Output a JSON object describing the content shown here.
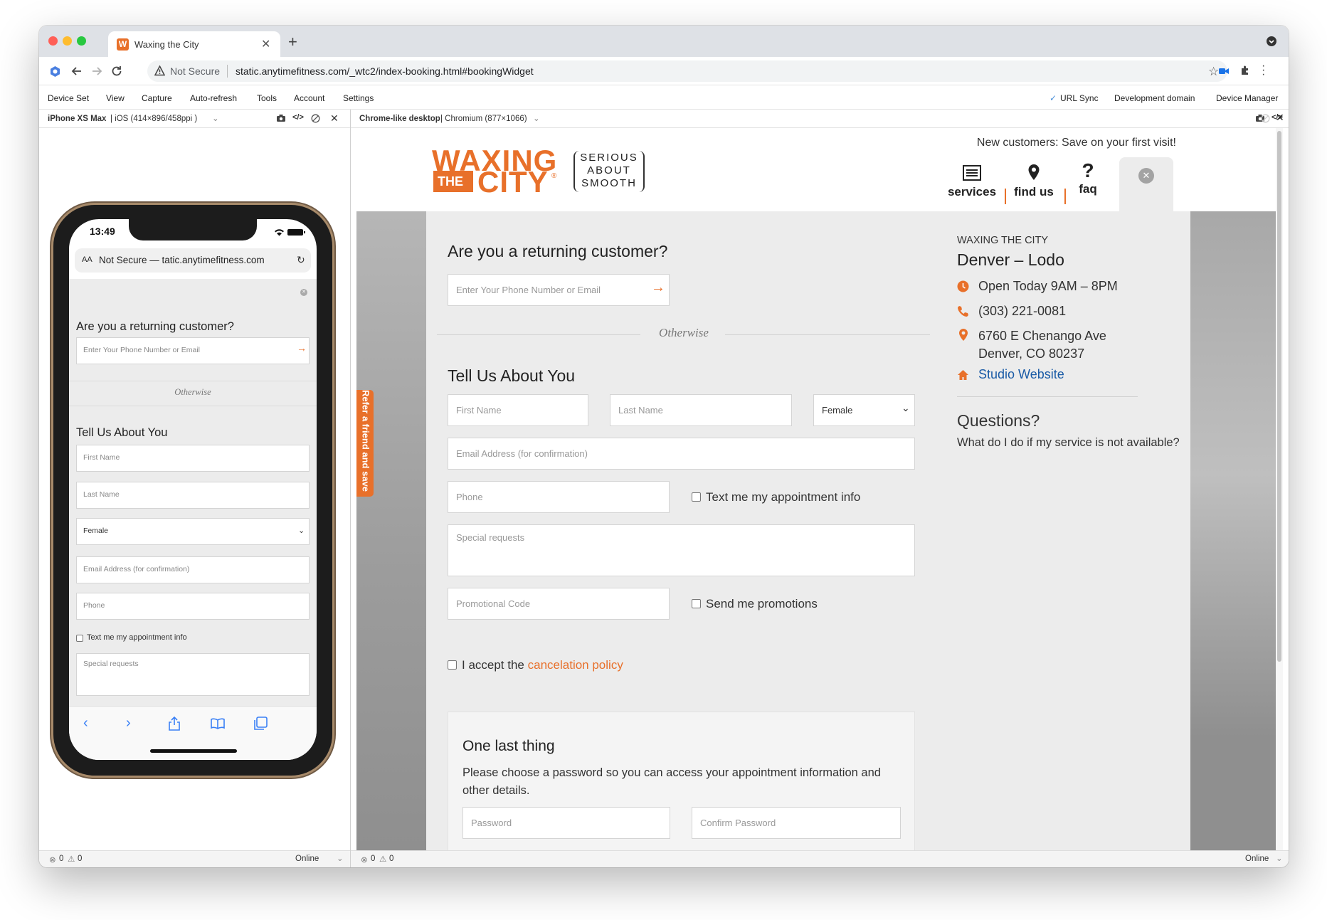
{
  "browser": {
    "tab_title": "Waxing the City",
    "tab_favicon": "W",
    "new_tab": "+",
    "security_label": "Not Secure",
    "url": "static.anytimefitness.com/_wtc2/index-booking.html#bookingWidget"
  },
  "app_menu": {
    "items": [
      "Device Set",
      "View",
      "Capture",
      "Auto-refresh",
      "Tools",
      "Account",
      "Settings"
    ],
    "url_sync": "URL Sync",
    "development_domain": "Development domain",
    "device_manager": "Device Manager"
  },
  "phone_pane": {
    "device_name": "iPhone XS Max",
    "device_info": "| iOS (414×896/458ppi )",
    "status_errors": "0",
    "status_warnings": "0",
    "network": "Online",
    "phone": {
      "time": "13:49",
      "aa": "AA",
      "address": "Not Secure — tatic.anytimefitness.com",
      "returning_heading": "Are you a returning customer?",
      "lookup_placeholder": "Enter Your Phone Number or Email",
      "otherwise": "Otherwise",
      "tell_us_heading": "Tell Us About You",
      "first_name": "First Name",
      "last_name": "Last Name",
      "gender": "Female",
      "email": "Email Address (for confirmation)",
      "phone": "Phone",
      "text_me": "Text me my appointment info",
      "special_requests": "Special requests"
    }
  },
  "desktop_pane": {
    "device_name": "Chrome-like desktop",
    "device_info": "| Chromium (877×1066)",
    "status_errors": "0",
    "status_warnings": "0",
    "network": "Online"
  },
  "site": {
    "logo": {
      "line1": "WAXING",
      "the": "THE",
      "city": "CITY",
      "reg": "®",
      "tagline": [
        "SERIOUS",
        "ABOUT",
        "SMOOTH"
      ],
      "tagline_reg": "®"
    },
    "promo": "New customers: Save on your first visit!",
    "nav": [
      {
        "label": "services",
        "icon": "list-icon"
      },
      {
        "label": "find us",
        "icon": "map-pin-icon"
      },
      {
        "label": "faq",
        "icon": "question-mark-icon"
      }
    ],
    "refer_tab": "Refer a friend and save",
    "form": {
      "returning_heading": "Are you a returning customer?",
      "lookup_placeholder": "Enter Your Phone Number or Email",
      "otherwise": "Otherwise",
      "tell_us_heading": "Tell Us About You",
      "first_name": "First Name",
      "last_name": "Last Name",
      "gender": "Female",
      "email": "Email Address (for confirmation)",
      "phone": "Phone",
      "text_me": "Text me my appointment info",
      "special_requests": "Special requests",
      "promo_code": "Promotional Code",
      "send_promos": "Send me promotions",
      "accept_prefix": "I accept the",
      "cancel_policy": "cancelation policy",
      "last_thing_heading": "One last thing",
      "last_thing_text": "Please choose a password so you can access your appointment information and other details.",
      "password": "Password",
      "confirm_password": "Confirm Password"
    },
    "studio": {
      "brand": "WAXING THE CITY",
      "name": "Denver – Lodo",
      "hours": "Open Today 9AM – 8PM",
      "phone": "(303) 221-0081",
      "address_line1": "6760 E Chenango Ave",
      "address_line2": "Denver, CO 80237",
      "website": "Studio Website"
    },
    "questions": {
      "heading": "Questions?",
      "text": "What do I do if my service is not available?"
    },
    "colors": {
      "brand_orange": "#e8702a",
      "link_blue": "#1a5ba6"
    }
  }
}
